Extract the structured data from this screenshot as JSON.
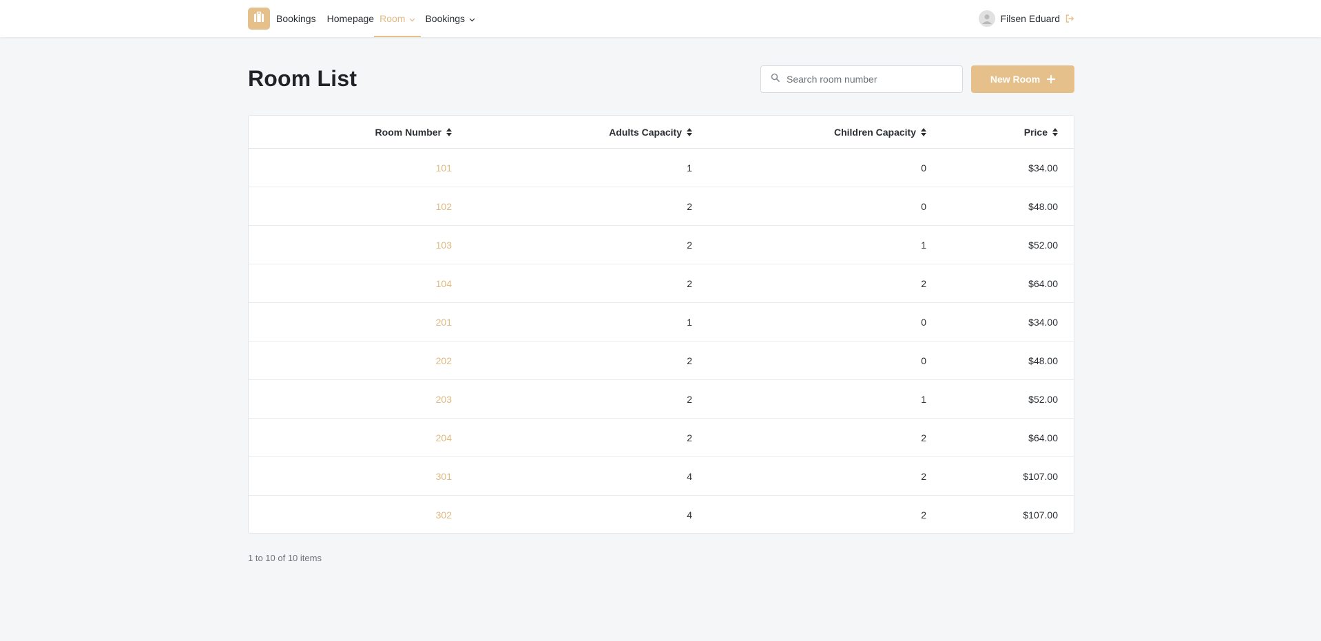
{
  "nav": {
    "brand": "Bookings",
    "links": [
      {
        "label": "Homepage"
      },
      {
        "label": "Room"
      },
      {
        "label": "Bookings"
      }
    ],
    "user_name": "Filsen Eduard"
  },
  "page": {
    "title": "Room List",
    "search_placeholder": "Search room number",
    "new_button": "New Room"
  },
  "table": {
    "columns": [
      "Room Number",
      "Adults Capacity",
      "Children Capacity",
      "Price"
    ],
    "rows": [
      {
        "room": "101",
        "adults": "1",
        "children": "0",
        "price": "$34.00"
      },
      {
        "room": "102",
        "adults": "2",
        "children": "0",
        "price": "$48.00"
      },
      {
        "room": "103",
        "adults": "2",
        "children": "1",
        "price": "$52.00"
      },
      {
        "room": "104",
        "adults": "2",
        "children": "2",
        "price": "$64.00"
      },
      {
        "room": "201",
        "adults": "1",
        "children": "0",
        "price": "$34.00"
      },
      {
        "room": "202",
        "adults": "2",
        "children": "0",
        "price": "$48.00"
      },
      {
        "room": "203",
        "adults": "2",
        "children": "1",
        "price": "$52.00"
      },
      {
        "room": "204",
        "adults": "2",
        "children": "2",
        "price": "$64.00"
      },
      {
        "room": "301",
        "adults": "4",
        "children": "2",
        "price": "$107.00"
      },
      {
        "room": "302",
        "adults": "4",
        "children": "2",
        "price": "$107.00"
      }
    ]
  },
  "pager": {
    "info": "1 to 10 of 10 items"
  },
  "colors": {
    "accent": "#e6c08a",
    "accent_text": "#e0b97f",
    "background": "#f4f6f8"
  },
  "icons": {
    "brand": "suitcase-icon",
    "dropdown": "chevron-down-icon",
    "avatar": "user-avatar-icon",
    "logout": "logout-icon",
    "search": "search-icon",
    "add": "plus-icon",
    "sort": "sort-icon"
  }
}
